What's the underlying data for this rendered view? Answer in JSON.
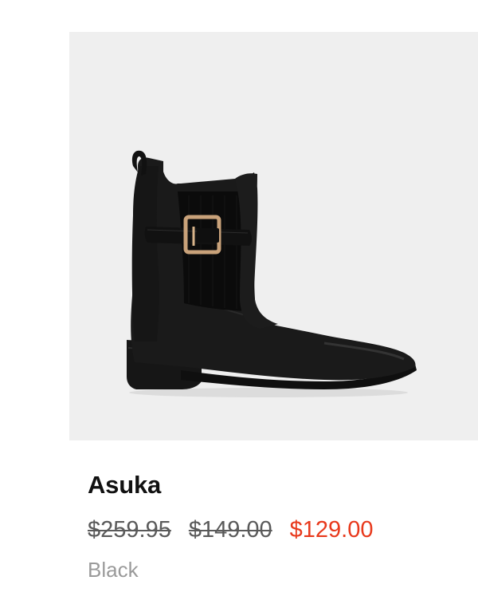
{
  "product": {
    "image_alt": "Black leather ankle boot with elastic side panel and gold buckle strap",
    "name": "Asuka",
    "prices": {
      "original": "$259.95",
      "previous": "$149.00",
      "current": "$129.00"
    },
    "color": "Black"
  },
  "theme": {
    "image_background": "#efefef",
    "sale_price_color": "#e8391c",
    "strikethrough_color": "#5a5a5a",
    "secondary_text_color": "#9a9a9a"
  }
}
